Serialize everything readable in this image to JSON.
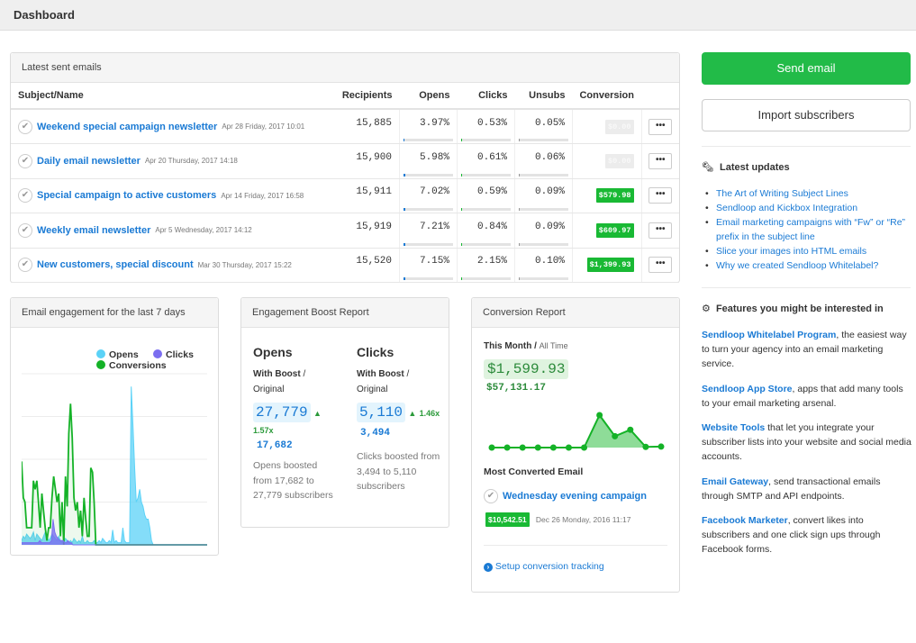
{
  "header": {
    "title": "Dashboard"
  },
  "emails": {
    "panel_title": "Latest sent emails",
    "columns": [
      "Subject/Name",
      "Recipients",
      "Opens",
      "Clicks",
      "Unsubs",
      "Conversion"
    ],
    "more_label": "•••",
    "bar_color_opens": "#1a7ad4",
    "bar_color_clicks": "#19b934",
    "rows": [
      {
        "subject": "Weekend special campaign newsletter",
        "date": "Apr 28 Friday, 2017 10:01",
        "recipients": "15,885",
        "opens": "3.97%",
        "clicks": "0.53%",
        "unsubs": "0.05%",
        "conversion": "$0.00",
        "converted": false,
        "opens_pct": 3.97,
        "clicks_pct": 0.53,
        "unsubs_pct": 0.05
      },
      {
        "subject": "Daily email newsletter",
        "date": "Apr 20 Thursday, 2017 14:18",
        "recipients": "15,900",
        "opens": "5.98%",
        "clicks": "0.61%",
        "unsubs": "0.06%",
        "conversion": "$0.00",
        "converted": false,
        "opens_pct": 5.98,
        "clicks_pct": 0.61,
        "unsubs_pct": 0.06
      },
      {
        "subject": "Special campaign to active customers",
        "date": "Apr 14 Friday, 2017 16:58",
        "recipients": "15,911",
        "opens": "7.02%",
        "clicks": "0.59%",
        "unsubs": "0.09%",
        "conversion": "$579.98",
        "converted": true,
        "opens_pct": 7.02,
        "clicks_pct": 0.59,
        "unsubs_pct": 0.09
      },
      {
        "subject": "Weekly email newsletter",
        "date": "Apr 5 Wednesday, 2017 14:12",
        "recipients": "15,919",
        "opens": "7.21%",
        "clicks": "0.84%",
        "unsubs": "0.09%",
        "conversion": "$609.97",
        "converted": true,
        "opens_pct": 7.21,
        "clicks_pct": 0.84,
        "unsubs_pct": 0.09
      },
      {
        "subject": "New customers, special discount",
        "date": "Mar 30 Thursday, 2017 15:22",
        "recipients": "15,520",
        "opens": "7.15%",
        "clicks": "2.15%",
        "unsubs": "0.10%",
        "conversion": "$1,399.93",
        "converted": true,
        "opens_pct": 7.15,
        "clicks_pct": 2.15,
        "unsubs_pct": 0.1
      }
    ]
  },
  "actions": {
    "send_email": "Send email",
    "import_subscribers": "Import subscribers"
  },
  "updates": {
    "icon": "newspaper-icon",
    "title": "Latest updates",
    "items": [
      "The Art of Writing Subject Lines",
      "Sendloop and Kickbox Integration",
      "Email marketing campaigns with “Fw” or “Re” prefix in the subject line",
      "Slice your images into HTML emails",
      "Why we created Sendloop Whitelabel?"
    ]
  },
  "features": {
    "icon": "gear-icon",
    "title": "Features you might be interested in",
    "items": [
      {
        "link": "Sendloop Whitelabel Program",
        "text": ", the easiest way to turn your agency into an email marketing service."
      },
      {
        "link": "Sendloop App Store",
        "text": ", apps that add many tools to your email marketing arsenal."
      },
      {
        "link": "Website Tools",
        "text": " that let you integrate your subscriber lists into your website and social media accounts."
      },
      {
        "link": "Email Gateway",
        "text": ", send transactional emails through SMTP and API endpoints."
      },
      {
        "link": "Facebook Marketer",
        "text": ", convert likes into subscribers and one click sign ups through Facebook forms."
      }
    ]
  },
  "engagement": {
    "panel_title": "Email engagement for the last 7 days",
    "legend": [
      {
        "label": "Opens",
        "color": "#5bd2f7"
      },
      {
        "label": "Clicks",
        "color": "#7b6ef0"
      },
      {
        "label": "Conversions",
        "color": "#14b227"
      }
    ]
  },
  "chart_data": [
    {
      "type": "area",
      "title": "Email engagement for the last 7 days",
      "xlabel": "",
      "ylabel": "",
      "ylim": [
        0,
        4
      ],
      "grid": true,
      "legend_position": "top-right",
      "series": [
        {
          "name": "Opens",
          "color": "#5bd2f7",
          "values": [
            0.1,
            0.2,
            0.15,
            0.25,
            0.2,
            0.15,
            0.2,
            0.3,
            0.1,
            0.25,
            0.2,
            0.15,
            0.1,
            0.2,
            0.3,
            0.2,
            0.1,
            0.15,
            0.25,
            0.2,
            0.15,
            0.1,
            0.2,
            0.1,
            0.05,
            0.1,
            0.15,
            0.1,
            0.05,
            0.1,
            0.05,
            0.15,
            0.1,
            0.05,
            0.1,
            0.05,
            0.2,
            0.05,
            0.05,
            0.1,
            0.05,
            0.05,
            0.05,
            0.1,
            0.05,
            0.05,
            0.1,
            0.05,
            0.15,
            0.1,
            0.05,
            0.05,
            0.1,
            0.05,
            0.35,
            0.05,
            0.1,
            0.05,
            0.05,
            0.05,
            0.4,
            0.1,
            0.05,
            0.05,
            0.05,
            3.7,
            2.8,
            1.8,
            1.0,
            1.1,
            1.3,
            1.0,
            0.9,
            0.7,
            0.6,
            0.6,
            0.4,
            0.1,
            0,
            0,
            0,
            0,
            0,
            0,
            0,
            0,
            0,
            0,
            0,
            0,
            0,
            0,
            0,
            0,
            0,
            0,
            0,
            0,
            0,
            0,
            0,
            0,
            0,
            0,
            0,
            0,
            0,
            0,
            0,
            0,
            0
          ]
        },
        {
          "name": "Clicks",
          "color": "#7b6ef0",
          "values": [
            0.05,
            0.05,
            0.05,
            0.05,
            0.05,
            0.05,
            0.05,
            0.05,
            0.05,
            0.05,
            0.05,
            0.1,
            0.05,
            0.05,
            0.05,
            0.05,
            0.05,
            0.05,
            0.1,
            0.6,
            0.3,
            0.2,
            0.15,
            0.1,
            0.1,
            0.1,
            0.05,
            0.05,
            0.1,
            0.05,
            0.05,
            0,
            0,
            0,
            0,
            0,
            0,
            0,
            0,
            0,
            0,
            0,
            0,
            0,
            0,
            0,
            0,
            0,
            0,
            0,
            0,
            0,
            0,
            0,
            0,
            0,
            0,
            0,
            0,
            0,
            0,
            0,
            0,
            0,
            0,
            0,
            0,
            0,
            0,
            0,
            0,
            0,
            0,
            0,
            0,
            0,
            0,
            0,
            0,
            0,
            0,
            0,
            0,
            0,
            0,
            0,
            0,
            0,
            0,
            0,
            0,
            0,
            0,
            0,
            0,
            0,
            0,
            0,
            0,
            0,
            0,
            0,
            0,
            0,
            0,
            0,
            0,
            0,
            0,
            0,
            0,
            0,
            0
          ]
        },
        {
          "name": "Conversions",
          "color": "#14b227",
          "values": [
            1.95,
            1.1,
            1.0,
            0.4,
            0.4,
            0.4,
            0.4,
            1.5,
            1.3,
            1.5,
            1.0,
            0.4,
            1.2,
            0.8,
            0.4,
            0.1,
            0.4,
            0.4,
            1.1,
            1.6,
            1.3,
            1.0,
            1.2,
            0.2,
            1.0,
            0.0,
            1.6,
            0.9,
            2.6,
            3.3,
            2.5,
            1.1,
            0.8,
            1.0,
            0.4,
            0.8,
            0.2,
            1.1,
            0.6,
            0.2,
            0.2,
            1.8,
            1.7,
            1.0,
            0,
            0,
            0,
            0,
            0,
            0,
            0,
            0,
            0,
            0,
            0,
            0,
            0,
            0,
            0,
            0,
            0,
            0,
            0,
            0,
            0,
            0,
            0,
            0,
            0,
            0,
            0,
            0,
            0,
            0,
            0,
            0,
            0,
            0,
            0,
            0,
            0,
            0,
            0,
            0,
            0,
            0,
            0,
            0,
            0,
            0,
            0,
            0,
            0,
            0,
            0,
            0,
            0,
            0,
            0,
            0,
            0,
            0,
            0,
            0,
            0,
            0,
            0,
            0,
            0,
            0,
            0
          ]
        }
      ]
    },
    {
      "type": "area",
      "title": "Conversion Report sparkline",
      "xlabel": "",
      "ylabel": "",
      "ylim": [
        0,
        1
      ],
      "grid": false,
      "series": [
        {
          "name": "Conversions",
          "color": "#14b227",
          "values": [
            0,
            0,
            0,
            0,
            0,
            0,
            0,
            1.0,
            0.35,
            0.55,
            0.02,
            0.03
          ]
        }
      ]
    }
  ],
  "boost": {
    "panel_title": "Engagement Boost Report",
    "opens": {
      "title": "Opens",
      "with_boost": "With Boost",
      "original_label": "Original",
      "boosted": "27,779",
      "multiplier": "1.57x",
      "original": "17,682",
      "description": "Opens boosted from 17,682 to 27,779 subscribers"
    },
    "clicks": {
      "title": "Clicks",
      "with_boost": "With Boost",
      "original_label": "Original",
      "boosted": "5,110",
      "multiplier": "1.46x",
      "original": "3,494",
      "description": "Clicks boosted from 3,494 to 5,110 subscribers"
    }
  },
  "conversion": {
    "panel_title": "Conversion Report",
    "this_month_label": "This Month",
    "all_time_label": "All Time",
    "this_month": "$1,599.93",
    "all_time": "$57,131.17",
    "most_converted_title": "Most Converted Email",
    "most_converted_name": "Wednesday evening campaign",
    "most_converted_value": "$10,542.51",
    "most_converted_date": "Dec 26 Monday, 2016 11:17",
    "setup_link": "Setup conversion tracking"
  }
}
